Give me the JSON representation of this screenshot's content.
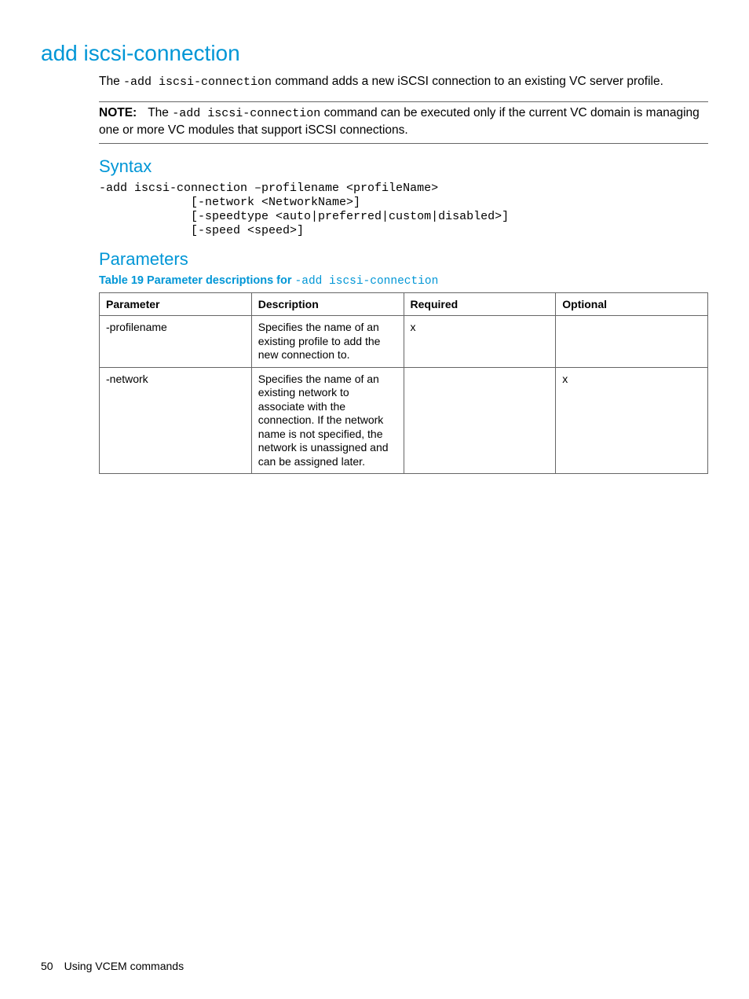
{
  "heading": "add iscsi-connection",
  "intro_pre": "The ",
  "intro_code": "-add iscsi-connection",
  "intro_post": " command adds a new iSCSI connection to an existing VC server profile.",
  "note_label": "NOTE:",
  "note_pre": "The ",
  "note_code": "-add iscsi-connection",
  "note_post": " command can be executed only if the current VC domain is managing one or more VC modules that support iSCSI connections.",
  "syntax_heading": "Syntax",
  "syntax_block": "-add iscsi-connection –profilename <profileName>\n             [-network <NetworkName>]\n             [-speedtype <auto|preferred|custom|disabled>]\n             [-speed <speed>]",
  "params_heading": "Parameters",
  "table_caption_bold": "Table 19 Parameter descriptions for ",
  "table_caption_code": "-add iscsi-connection",
  "table": {
    "headers": {
      "param": "Parameter",
      "desc": "Description",
      "required": "Required",
      "optional": "Optional"
    },
    "rows": [
      {
        "param": "-profilename",
        "desc": "Specifies the name of an existing profile to add the new connection to.",
        "required": "x",
        "optional": ""
      },
      {
        "param": "-network",
        "desc": "Specifies the name of an existing network to associate with the connection. If the network name is not specified, the network is unassigned and can be assigned later.",
        "required": "",
        "optional": "x"
      }
    ]
  },
  "footer": {
    "page": "50",
    "section": "Using VCEM commands"
  }
}
